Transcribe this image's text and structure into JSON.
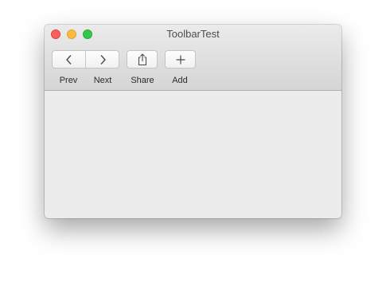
{
  "window": {
    "title": "ToolbarTest"
  },
  "toolbar": {
    "prev_label": "Prev",
    "next_label": "Next",
    "share_label": "Share",
    "add_label": "Add",
    "icons": {
      "prev": "chevron-left-icon",
      "next": "chevron-right-icon",
      "share": "share-icon",
      "add": "plus-icon"
    }
  },
  "colors": {
    "close": "#fc605c",
    "minimize": "#fdbc40",
    "maximize": "#34c84a",
    "content_background": "#ececec"
  }
}
